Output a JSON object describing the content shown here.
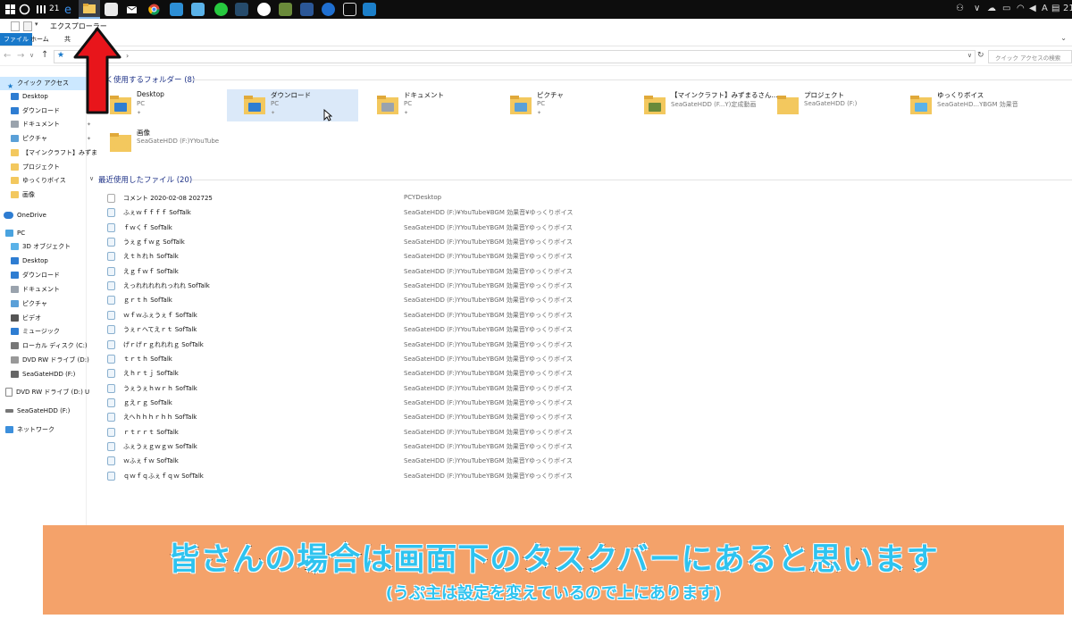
{
  "taskbar": {
    "clock": "21",
    "ime_label": "A"
  },
  "window": {
    "title": "エクスプローラー",
    "ribbon_tabs": [
      "ファイル",
      "ホーム",
      "共"
    ],
    "address_chevron": "›",
    "search_placeholder": "クイック アクセスの検索"
  },
  "nav": {
    "quick_access_label": "クイック アクセス",
    "quick_items": [
      "Desktop",
      "ダウンロード",
      "ドキュメント",
      "ピクチャ",
      "【マインクラフト】みずま",
      "プロジェクト",
      "ゆっくりボイス",
      "画像"
    ],
    "onedrive_label": "OneDrive",
    "pc_label": "PC",
    "pc_items": [
      "3D オブジェクト",
      "Desktop",
      "ダウンロード",
      "ドキュメント",
      "ピクチャ",
      "ビデオ",
      "ミュージック",
      "ローカル ディスク (C:)",
      "DVD RW ドライブ (D:)",
      "SeaGateHDD (F:)"
    ],
    "dvd_label": "DVD RW ドライブ (D:) U",
    "seagate_label": "SeaGateHDD (F:)",
    "network_label": "ネットワーク"
  },
  "frequent": {
    "title": "よく使用するフォルダー (8)",
    "folders": [
      {
        "name": "Desktop",
        "sub": "PC"
      },
      {
        "name": "ダウンロード",
        "sub": "PC"
      },
      {
        "name": "ドキュメント",
        "sub": "PC"
      },
      {
        "name": "ピクチャ",
        "sub": "PC"
      },
      {
        "name": "【マインクラフト】みずまるさん...",
        "sub": "SeaGateHDD (F...Y)定成動画"
      },
      {
        "name": "プロジェクト",
        "sub": "SeaGateHDD (F:)"
      },
      {
        "name": "ゆっくりボイス",
        "sub": "SeaGateHD...YBGM 効果音"
      },
      {
        "name": "画像",
        "sub": "SeaGateHDD (F:)YYouTube"
      }
    ]
  },
  "recent": {
    "title": "最近使用したファイル (20)",
    "files": [
      {
        "name": "コメント 2020-02-08 202725",
        "path": "PCYDesktop"
      },
      {
        "name": "ふぇｗｆｆｆｆ SofTalk",
        "path": "SeaGateHDD (F:)¥YouTube¥BGM 効果音¥ゆっくりボイス"
      },
      {
        "name": "ｆｗくｆ SofTalk",
        "path": "SeaGateHDD (F:)YYouTubeYBGM 効果音Yゆっくりボイス"
      },
      {
        "name": "うぇｇｆｗｇ SofTalk",
        "path": "SeaGateHDD (F:)YYouTubeYBGM 効果音Yゆっくりボイス"
      },
      {
        "name": "えｔｈれｈ SofTalk",
        "path": "SeaGateHDD (F:)YYouTubeYBGM 効果音Yゆっくりボイス"
      },
      {
        "name": "えｇｆｗｆ SofTalk",
        "path": "SeaGateHDD (F:)YYouTubeYBGM 効果音Yゆっくりボイス"
      },
      {
        "name": "えっれれれれれっれれ SofTalk",
        "path": "SeaGateHDD (F:)YYouTubeYBGM 効果音Yゆっくりボイス"
      },
      {
        "name": "ｇｒｔｈ SofTalk",
        "path": "SeaGateHDD (F:)YYouTubeYBGM 効果音Yゆっくりボイス"
      },
      {
        "name": "ｗｆｗふぇうぇｆ SofTalk",
        "path": "SeaGateHDD (F:)YYouTubeYBGM 効果音Yゆっくりボイス"
      },
      {
        "name": "うぇｒへてえｒｔ SofTalk",
        "path": "SeaGateHDD (F:)YYouTubeYBGM 効果音Yゆっくりボイス"
      },
      {
        "name": "げｒげｒｇれれれｇ SofTalk",
        "path": "SeaGateHDD (F:)YYouTubeYBGM 効果音Yゆっくりボイス"
      },
      {
        "name": "ｔｒｔｈ SofTalk",
        "path": "SeaGateHDD (F:)YYouTubeYBGM 効果音Yゆっくりボイス"
      },
      {
        "name": "えｈｒｔｊ SofTalk",
        "path": "SeaGateHDD (F:)YYouTubeYBGM 効果音Yゆっくりボイス"
      },
      {
        "name": "うぇうぇｈｗｒｈ SofTalk",
        "path": "SeaGateHDD (F:)YYouTubeYBGM 効果音Yゆっくりボイス"
      },
      {
        "name": "ｇえｒｇ SofTalk",
        "path": "SeaGateHDD (F:)YYouTubeYBGM 効果音Yゆっくりボイス"
      },
      {
        "name": "えへｈｈｈｒｈｈ SofTalk",
        "path": "SeaGateHDD (F:)YYouTubeYBGM 効果音Yゆっくりボイス"
      },
      {
        "name": "ｒｔｒｒｔ SofTalk",
        "path": "SeaGateHDD (F:)YYouTubeYBGM 効果音Yゆっくりボイス"
      },
      {
        "name": "ふぇうぇｇｗｇｗ SofTalk",
        "path": "SeaGateHDD (F:)YYouTubeYBGM 効果音Yゆっくりボイス"
      },
      {
        "name": "ｗふぇｆｗ SofTalk",
        "path": "SeaGateHDD (F:)YYouTubeYBGM 効果音Yゆっくりボイス"
      },
      {
        "name": "ｑｗｆｑふぇｆｑｗ SofTalk",
        "path": "SeaGateHDD (F:)YYouTubeYBGM 効果音Yゆっくりボイス"
      }
    ]
  },
  "caption": {
    "line1": "皆さんの場合は画面下のタスクバーにあると思います",
    "line2": "(うぷ主は設定を変えているので上にあります)"
  },
  "colors": {
    "accent": "#0078d7",
    "folder": "#f3c85e",
    "banner": "#f4a26a",
    "caption_text": "#2fc3ef",
    "arrow": "#e8151b"
  }
}
